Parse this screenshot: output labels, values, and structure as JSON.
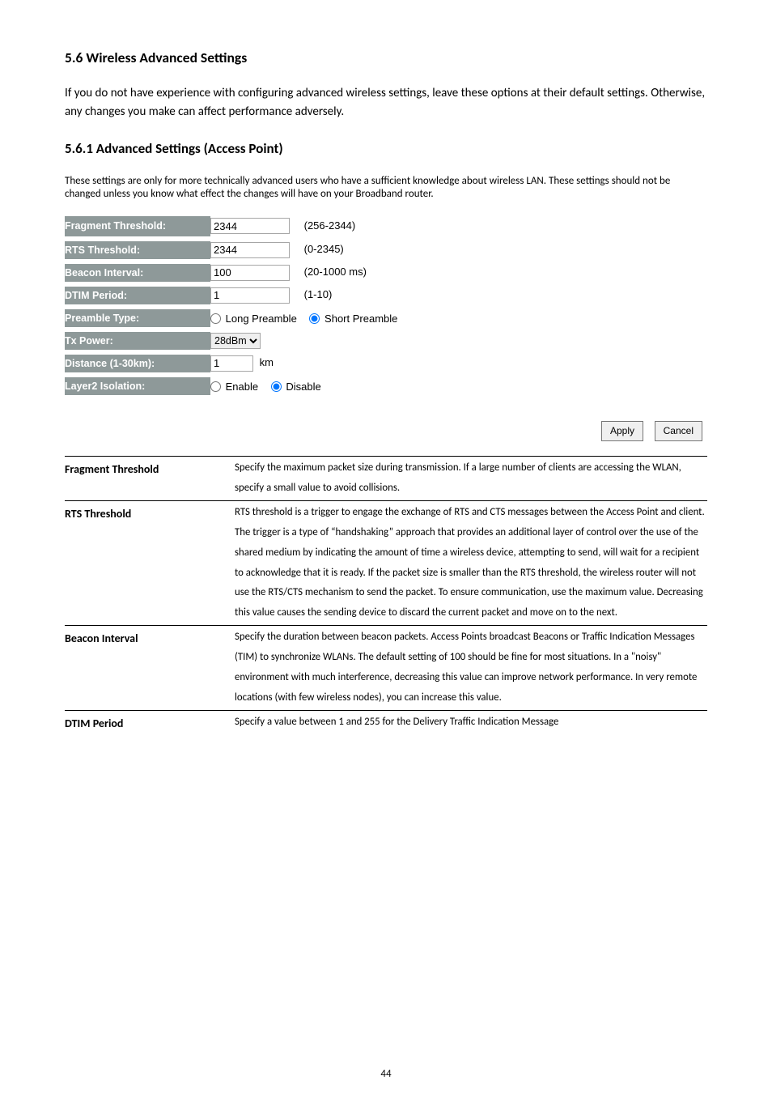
{
  "headings": {
    "h1": "5.6 Wireless Advanced Settings",
    "h2": "5.6.1 Advanced Settings (Access Point)"
  },
  "intro": "If you do not have experience with configuring advanced wireless settings, leave these options at their default settings. Otherwise, any changes you make can affect performance adversely.",
  "note": "These settings are only for more technically advanced users who have a sufficient knowledge about wireless LAN. These settings should not be changed unless you know what effect the changes will have on your Broadband router.",
  "form": {
    "fragment": {
      "label": "Fragment Threshold:",
      "value": "2344",
      "hint": "(256-2344)"
    },
    "rts": {
      "label": "RTS Threshold:",
      "value": "2344",
      "hint": "(0-2345)"
    },
    "beacon": {
      "label": "Beacon Interval:",
      "value": "100",
      "hint": "(20-1000 ms)"
    },
    "dtim": {
      "label": "DTIM Period:",
      "value": "1",
      "hint": "(1-10)"
    },
    "preamble": {
      "label": "Preamble Type:",
      "opt_long": "Long Preamble",
      "opt_short": "Short Preamble"
    },
    "tx": {
      "label": "Tx Power:",
      "selected": "28dBm"
    },
    "dist": {
      "label": "Distance (1-30km):",
      "value": "1",
      "unit": "km"
    },
    "iso": {
      "label": "Layer2 Isolation:",
      "opt_enable": "Enable",
      "opt_disable": "Disable"
    }
  },
  "buttons": {
    "apply": "Apply",
    "cancel": "Cancel"
  },
  "desc": {
    "fragment": {
      "label": "Fragment Threshold",
      "text": "Specify the maximum packet size during transmission. If a large number of clients are accessing the WLAN, specify a small value to avoid collisions."
    },
    "rts": {
      "label": "RTS Threshold",
      "text": "RTS threshold is a trigger to engage the exchange of RTS and CTS messages between the Access Point and client. The trigger is a type of “handshaking” approach that provides an additional layer of control over the use of the shared medium by indicating the amount of time a wireless device, attempting to send, will wait for a recipient to acknowledge that it is ready. If the packet size is smaller than the RTS threshold, the wireless router will not use the RTS/CTS mechanism to send the packet. To ensure communication, use the maximum value. Decreasing this value causes the sending device to discard the current packet and move on to the next."
    },
    "beacon": {
      "label": "Beacon Interval",
      "text": "Specify the duration between beacon packets. Access Points broadcast Beacons or Traffic Indication Messages (TIM) to synchronize WLANs. The default setting of 100 should be fine for most situations. In a \"noisy\" environment with much interference, decreasing this value can improve network performance. In very remote locations (with few wireless nodes), you can increase this value."
    },
    "dtim": {
      "label": "DTIM Period",
      "text": "Specify a value between 1 and 255 for the Delivery Traffic Indication Message"
    }
  },
  "page_number": "44"
}
